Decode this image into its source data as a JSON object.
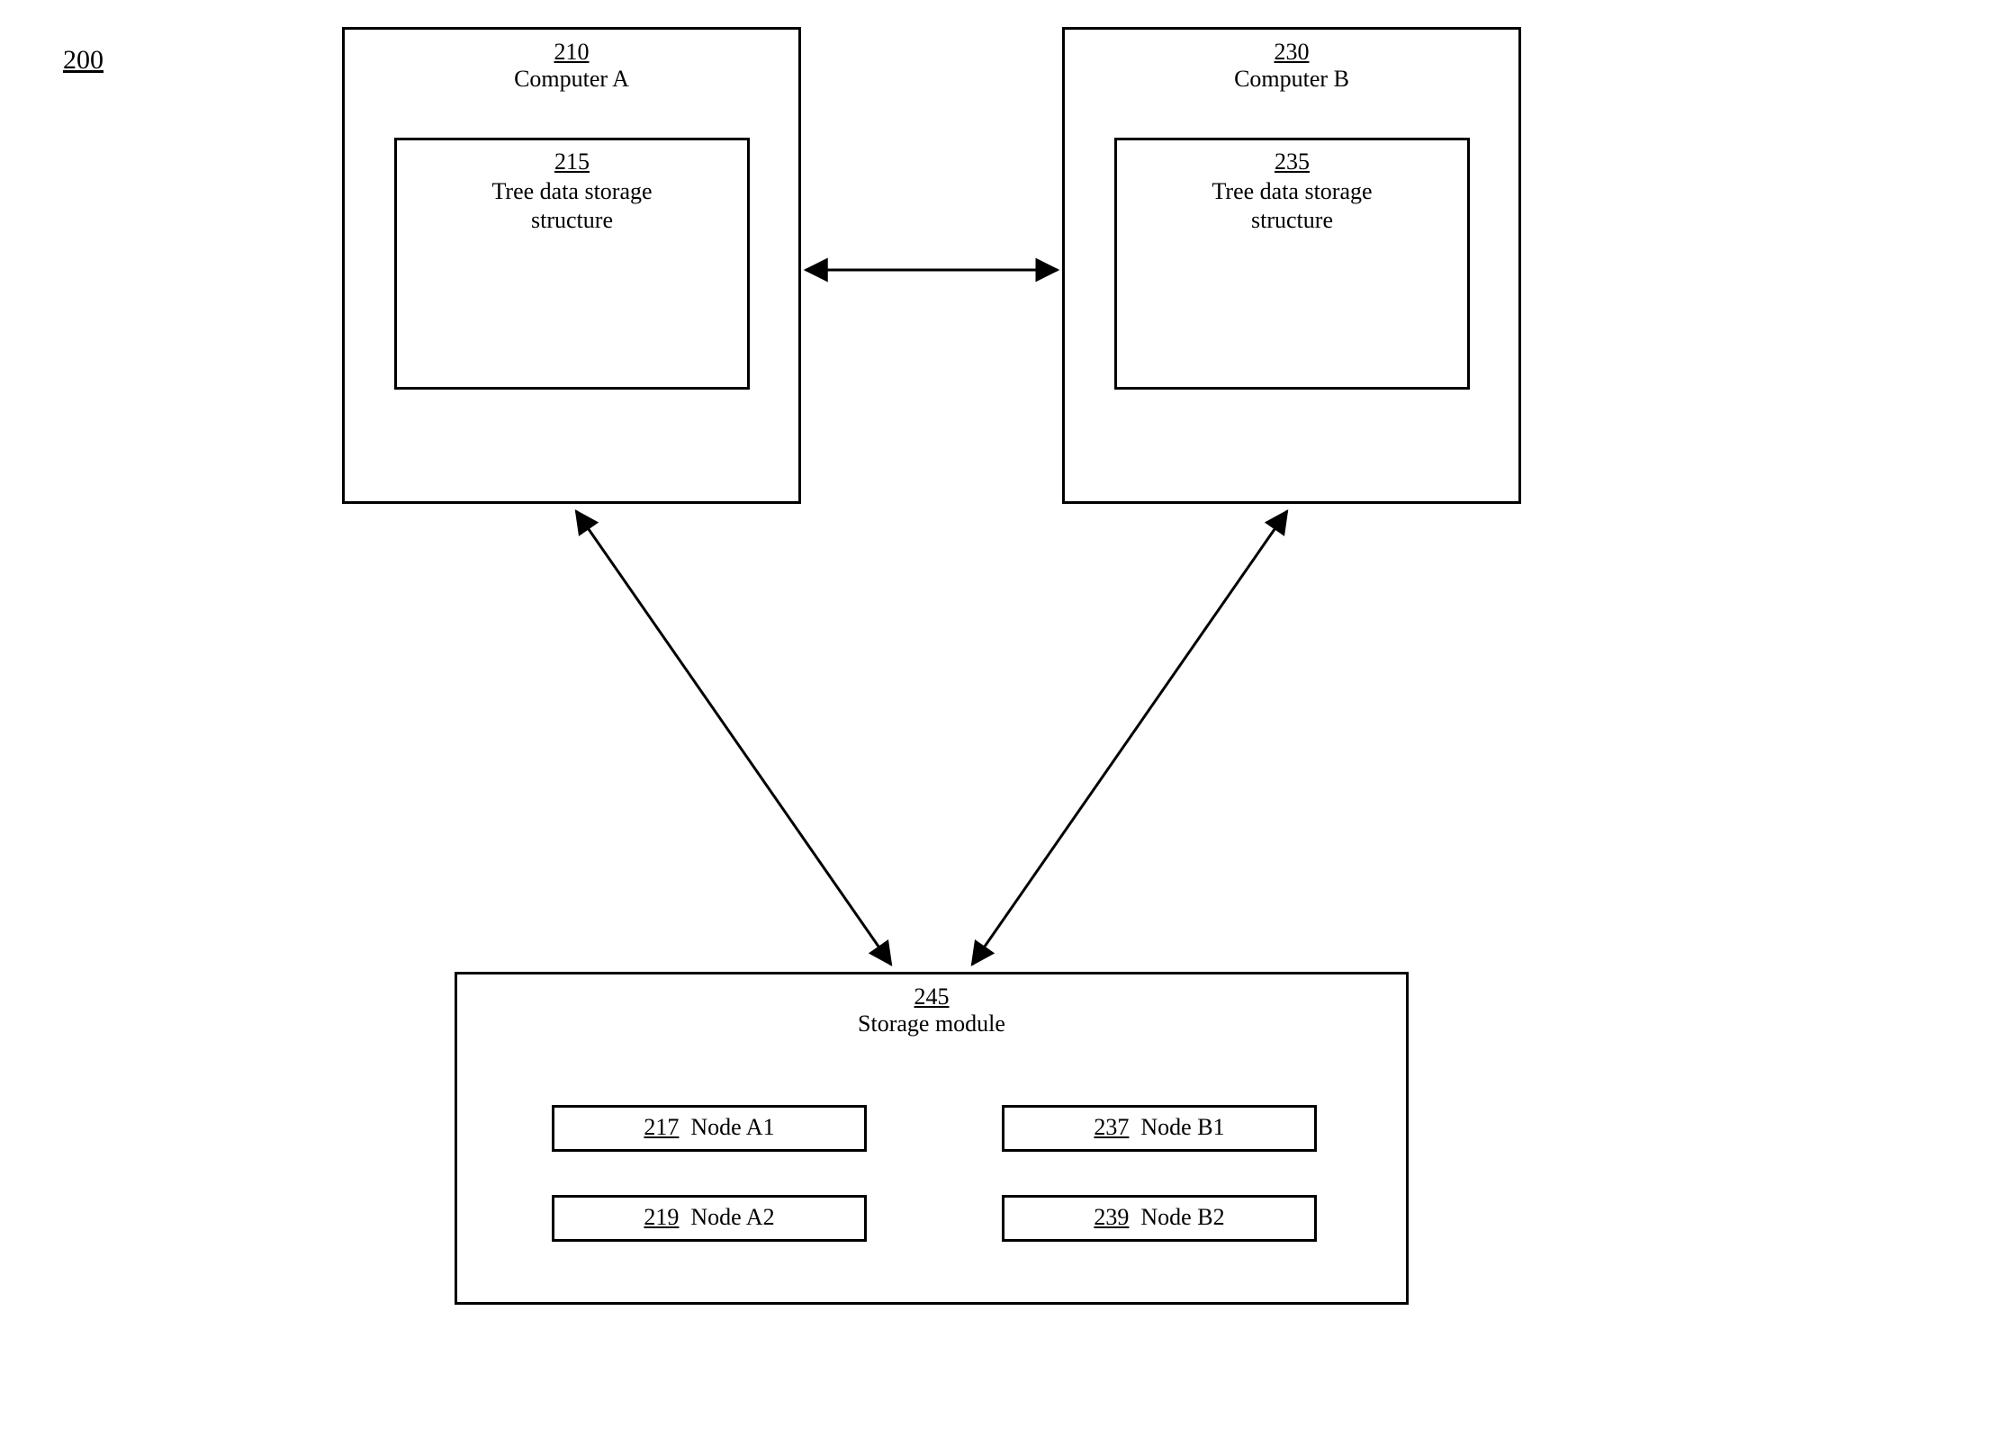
{
  "figure_number": "200",
  "computer_a": {
    "num": "210",
    "label": "Computer A",
    "tree": {
      "num": "215",
      "label_line1": "Tree data storage",
      "label_line2": "structure"
    }
  },
  "computer_b": {
    "num": "230",
    "label": "Computer B",
    "tree": {
      "num": "235",
      "label_line1": "Tree data storage",
      "label_line2": "structure"
    }
  },
  "storage": {
    "num": "245",
    "label": "Storage module",
    "nodes": {
      "a1": {
        "num": "217",
        "label": "Node A1"
      },
      "a2": {
        "num": "219",
        "label": "Node A2"
      },
      "b1": {
        "num": "237",
        "label": "Node B1"
      },
      "b2": {
        "num": "239",
        "label": "Node B2"
      }
    }
  }
}
